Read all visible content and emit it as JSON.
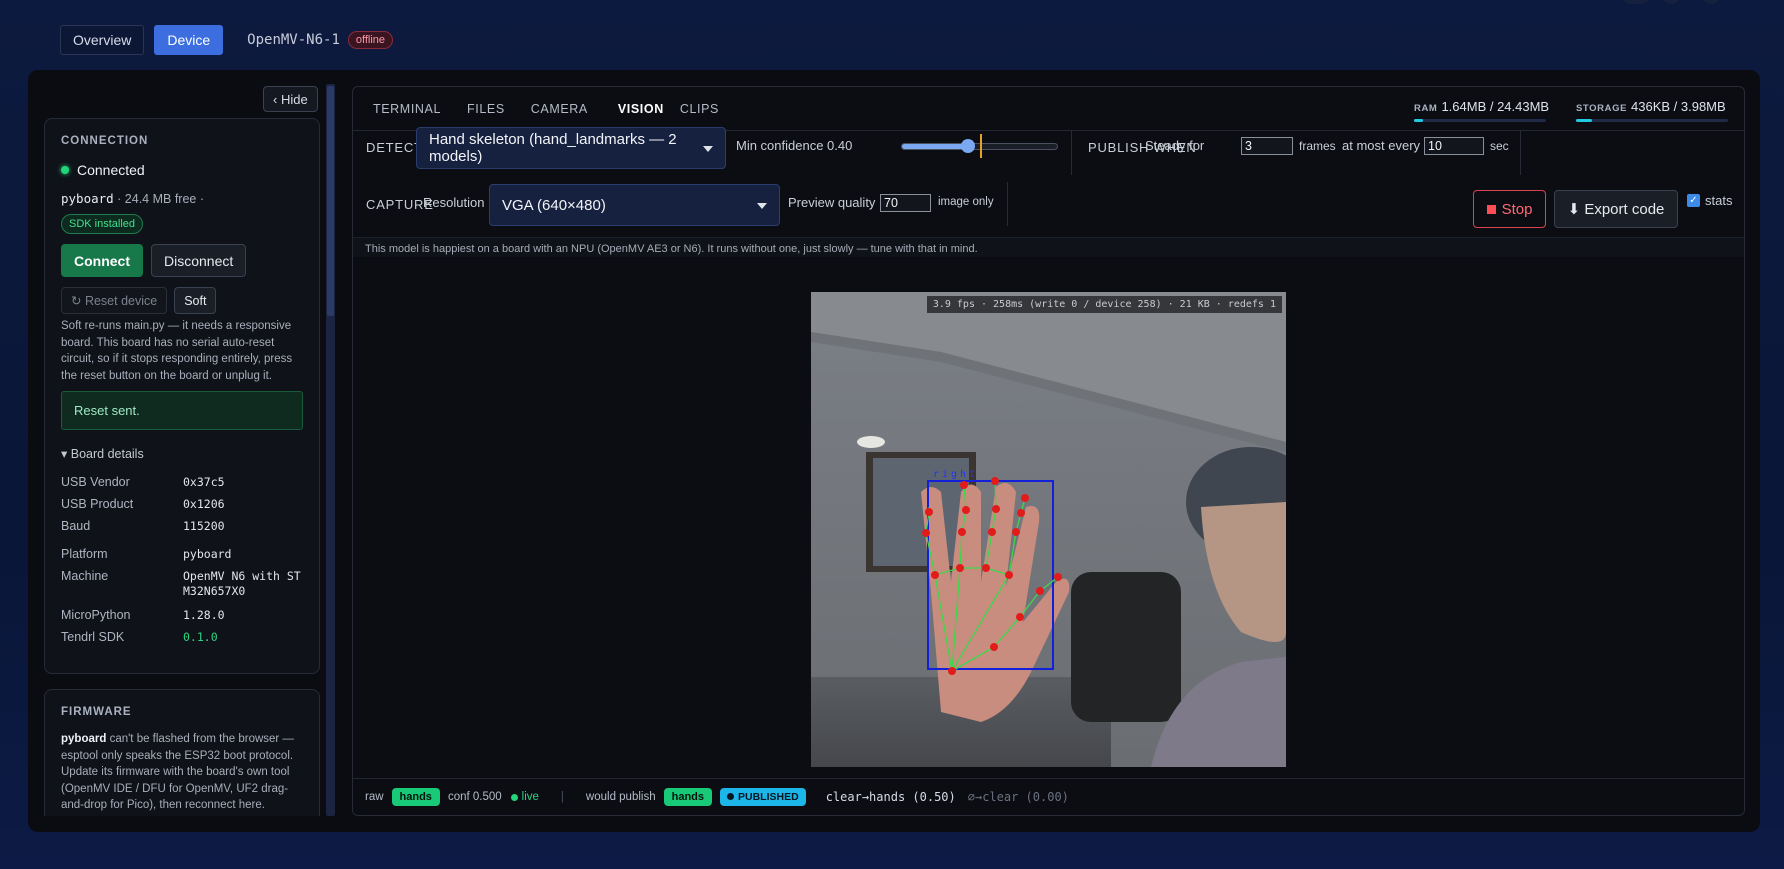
{
  "top": {
    "tabs": [
      {
        "label": "Overview"
      },
      {
        "label": "Device"
      }
    ],
    "device_name": "OpenMV-N6-1",
    "device_status": "offline"
  },
  "sidebar": {
    "hide_label": "‹ Hide",
    "connection": {
      "heading": "CONNECTION",
      "status": "Connected",
      "board": "pyboard",
      "free": "· 24.4 MB free ·",
      "sdk_badge": "SDK installed",
      "connect": "Connect",
      "disconnect": "Disconnect",
      "reset_device": "↻ Reset device",
      "soft": "Soft",
      "soft_note": "Soft re-runs main.py — it needs a responsive board. This board has no serial auto-reset circuit, so if it stops responding entirely, press the reset button on the board or unplug it.",
      "reset_sent": "Reset sent.",
      "board_details": "▾ Board details",
      "details": [
        {
          "k": "USB Vendor",
          "v": "0x37c5"
        },
        {
          "k": "USB Product",
          "v": "0x1206"
        },
        {
          "k": "Baud",
          "v": "115200"
        },
        {
          "k": "Platform",
          "v": "pyboard"
        },
        {
          "k": "Machine",
          "v": "OpenMV N6 with STM32N657X0"
        },
        {
          "k": "MicroPython",
          "v": "1.28.0"
        },
        {
          "k": "Tendrl SDK",
          "v": "0.1.0"
        }
      ]
    },
    "firmware": {
      "heading": "FIRMWARE",
      "board": "pyboard",
      "text": " can't be flashed from the browser — esptool only speaks the ESP32 boot protocol. Update its firmware with the board's own tool (OpenMV IDE / DFU for OpenMV, UF2 drag-and-drop for Pico), then reconnect here."
    }
  },
  "main": {
    "tabs": [
      "TERMINAL",
      "FILES",
      "CAMERA",
      "VISION",
      "CLIPS"
    ],
    "active_tab": "VISION",
    "ram": {
      "label": "RAM",
      "value": "1.64MB / 24.43MB",
      "fraction": 0.067
    },
    "storage": {
      "label": "STORAGE",
      "value": "436KB / 3.98MB",
      "fraction": 0.11
    },
    "detect": {
      "label": "DETECT",
      "selected": "Hand skeleton (hand_landmarks — 2 models)"
    },
    "min_conf": {
      "label": "Min confidence 0.40",
      "value": 0.4
    },
    "publish": {
      "label": "PUBLISH WHEN",
      "steady": "Steady for",
      "frames_value": "3",
      "frames": "frames",
      "at_most": "at most every",
      "sec_value": "10",
      "sec": "sec"
    },
    "capture": {
      "label": "CAPTURE",
      "resolution_label": "Resolution",
      "resolution": "VGA (640×480)",
      "preview_label": "Preview quality",
      "preview_value": "70",
      "image_only": "image only"
    },
    "stop": "Stop",
    "export": "⬇ Export code",
    "stats": "stats",
    "hint": "This model is happiest on a board with an NPU (OpenMV AE3 or N6). It runs without one, just slowly — tune with that in mind.",
    "video": {
      "stats": "3.9 fps · 258ms (write 0 / device 258) · 21 KB · redefs 1",
      "hand_label": "right"
    },
    "bottom": {
      "raw": "raw",
      "raw_pill": "hands",
      "conf": "conf 0.500",
      "live": "live",
      "sep": "|",
      "would": "would publish",
      "would_pill": "hands",
      "published": "PUBLISHED",
      "trans1": "clear→hands (0.50)",
      "trans2": "∅→clear (0.00)"
    }
  }
}
